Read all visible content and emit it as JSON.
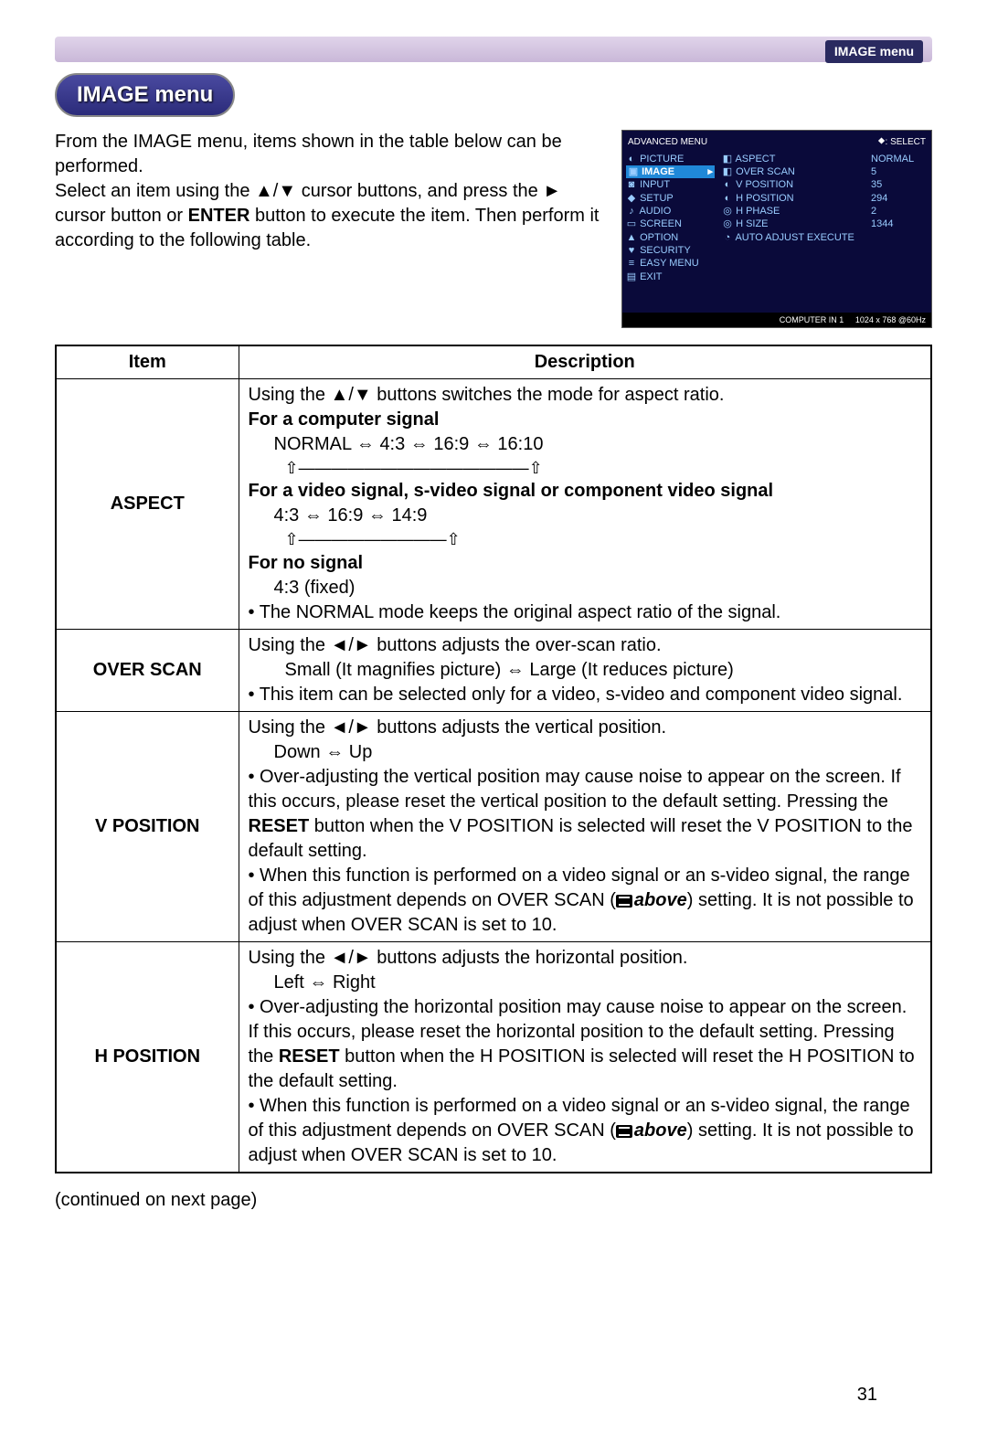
{
  "header": {
    "badge": "IMAGE menu"
  },
  "title": "IMAGE menu",
  "intro": {
    "p1": "From the IMAGE menu, items shown in the table below can be performed.",
    "p2a": "Select an item using the ▲/▼ cursor buttons, and press the ► cursor button or ",
    "p2b": "ENTER",
    "p2c": " button to execute the item. Then perform it according to the following table."
  },
  "osd": {
    "header_left": "ADVANCED MENU",
    "header_right": "⯁: SELECT",
    "left_items": [
      "PICTURE",
      "IMAGE",
      "INPUT",
      "SETUP",
      "AUDIO",
      "SCREEN",
      "OPTION",
      "SECURITY",
      "EASY MENU",
      "EXIT"
    ],
    "left_icons": [
      "◐",
      "▣",
      "◙",
      "◆",
      "♪",
      "▭",
      "▲",
      "♥",
      "≡",
      "▤"
    ],
    "mid_items": [
      "ASPECT",
      "OVER SCAN",
      "V POSITION",
      "H POSITION",
      "H PHASE",
      "H SIZE",
      "AUTO ADJUST EXECUTE"
    ],
    "mid_icons": [
      "◧",
      "◧",
      "◐",
      "◐",
      "◎",
      "◎",
      "◔"
    ],
    "right_vals": [
      "NORMAL",
      "5",
      "35",
      "294",
      "2",
      "1344",
      ""
    ],
    "footer_left": "COMPUTER IN 1",
    "footer_right": "1024 x 768 @60Hz"
  },
  "table": {
    "head_item": "Item",
    "head_desc": "Description",
    "rows": [
      {
        "item": "ASPECT",
        "d": {
          "l1": "Using the ▲/▼ buttons switches the mode for aspect ratio.",
          "h1": "For a computer signal",
          "v1": "NORMAL ⇔ 4:3 ⇔ 16:9 ⇔ 16:10",
          "a1": "⇧――――――――――――――⇧",
          "h2": "For a video signal, s-video signal or component video signal",
          "v2": "4:3 ⇔ 16:9 ⇔ 14:9",
          "a2": "⇧―――――――――⇧",
          "h3": "For no signal",
          "v3": "4:3 (fixed)",
          "n1": "• The NORMAL mode keeps the original aspect ratio of the signal."
        }
      },
      {
        "item": "OVER SCAN",
        "d": {
          "l1": "Using the ◄/► buttons adjusts the over-scan ratio.",
          "v1": "Small (It magnifies picture) ⇔ Large (It reduces picture)",
          "n1": "• This item can be selected only for a video, s-video and component video signal."
        }
      },
      {
        "item": "V POSITION",
        "d": {
          "l1": "Using the ◄/► buttons adjusts the vertical position.",
          "v1": "Down ⇔ Up",
          "n1a": "• Over-adjusting the vertical position may cause noise to appear on the screen. If this occurs, please reset the vertical position to the default setting. Pressing the ",
          "n1b": "RESET",
          "n1c": " button when the V POSITION is selected will reset the V POSITION to the default setting.",
          "n2a": "• When this function is performed on a video signal or an s-video signal, the range of this adjustment depends on OVER SCAN (",
          "n2ref": "above",
          "n2b": ") setting. It is not possible to adjust when OVER SCAN is set to 10."
        }
      },
      {
        "item": "H POSITION",
        "d": {
          "l1": "Using the ◄/► buttons adjusts the horizontal position.",
          "v1": "Left ⇔ Right",
          "n1a": "• Over-adjusting the horizontal position may cause noise to appear on the screen. If this occurs, please reset the horizontal position to the default setting. Pressing the ",
          "n1b": "RESET",
          "n1c": " button when the H POSITION is selected will reset the H POSITION to the default setting.",
          "n2a": "• When this function is performed on a video signal or an s-video signal, the range of this adjustment depends on OVER SCAN (",
          "n2ref": "above",
          "n2b": ") setting. It is not possible to adjust when OVER SCAN is set to 10."
        }
      }
    ]
  },
  "continued": "(continued on next page)",
  "page_num": "31"
}
